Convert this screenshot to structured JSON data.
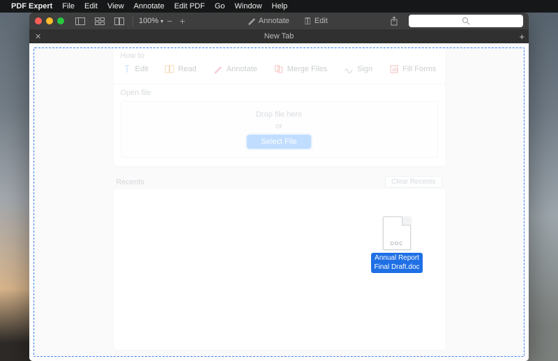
{
  "menubar": {
    "app": "PDF Expert",
    "items": [
      "File",
      "Edit",
      "View",
      "Annotate",
      "Edit PDF",
      "Go",
      "Window",
      "Help"
    ]
  },
  "toolbar": {
    "zoom": "100%",
    "annotate_label": "Annotate",
    "edit_label": "Edit"
  },
  "tabbar": {
    "title": "New Tab"
  },
  "howto": {
    "heading": "How to",
    "items": [
      {
        "label": "Edit"
      },
      {
        "label": "Read"
      },
      {
        "label": "Annotate"
      },
      {
        "label": "Merge Files"
      },
      {
        "label": "Sign"
      },
      {
        "label": "Fill Forms"
      }
    ]
  },
  "open": {
    "heading": "Open file",
    "drop_line1": "Drop file here",
    "drop_line2": "or",
    "select_btn": "Select File"
  },
  "recents": {
    "heading": "Recents",
    "clear": "Clear Recents"
  },
  "dragged_file": {
    "ext": "DOC",
    "name_line1": "Annual Report",
    "name_line2": "Final Draft.doc"
  }
}
